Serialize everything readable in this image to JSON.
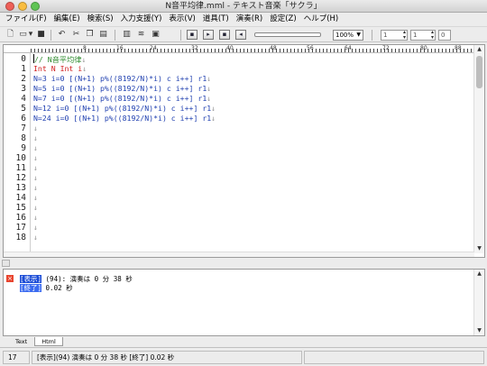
{
  "window": {
    "title": "N音平均律.mml - テキスト音楽「サクラ」"
  },
  "menu": [
    "ファイル(F)",
    "編集(E)",
    "検索(S)",
    "入力支援(Y)",
    "表示(V)",
    "道具(T)",
    "演奏(R)",
    "設定(Z)",
    "ヘルプ(H)"
  ],
  "toolbar": {
    "zoom": "100%",
    "spin1": "1",
    "spin2": "1",
    "spin3": "0"
  },
  "ruler": [
    "8",
    "16",
    "24",
    "32",
    "40",
    "48",
    "56",
    "64",
    "72",
    "80",
    "88"
  ],
  "editor": {
    "line_numbers": [
      "0",
      "1",
      "2",
      "3",
      "4",
      "5",
      "6",
      "7",
      "8",
      "9",
      "10",
      "11",
      "12",
      "13",
      "14",
      "15",
      "16",
      "17",
      "18"
    ],
    "line0": "// N音平均律",
    "line1": "Int N Int i",
    "lines": [
      "N=3 i=0 [(N+1) p%((8192/N)*i) c i++] r1",
      "N=5 i=0 [(N+1) p%((8192/N)*i) c i++] r1",
      "N=7 i=0 [(N+1) p%((8192/N)*i) c i++] r1",
      "N=12 i=0 [(N+1) p%((8192/N)*i) c i++] r1",
      "N=24 i=0 [(N+1) p%((8192/N)*i) c i++] r1"
    ],
    "eol_mark": "↓"
  },
  "output": {
    "tag1": "[表示]",
    "msg1": " (94): 演奏は 0 分 38 秒",
    "tag2": "[終了]",
    "msg2": " 0.02 秒"
  },
  "tabs": {
    "text": "Text",
    "html": "Html"
  },
  "status": {
    "line": "17",
    "message": "[表示](94) 演奏は 0 分 38 秒 [終了] 0.02 秒"
  },
  "colors": {
    "comment": "#2d8a2d",
    "keyword": "#d02020",
    "text": "#2040b0",
    "tag": "#1a4bd6"
  }
}
